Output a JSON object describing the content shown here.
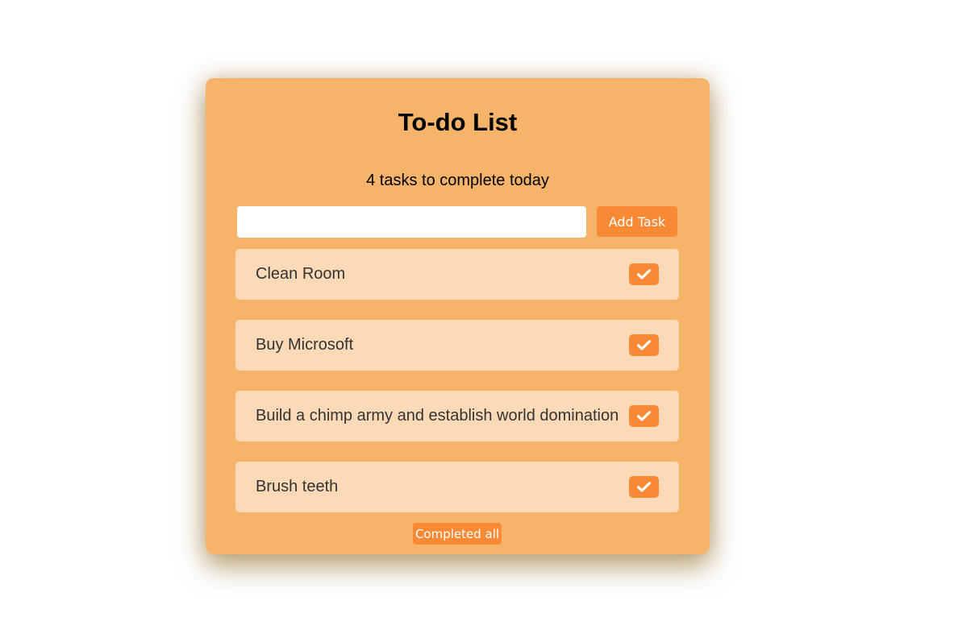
{
  "app": {
    "title": "To-do List",
    "summary": "4 tasks to complete today"
  },
  "input": {
    "value": "",
    "placeholder": ""
  },
  "buttons": {
    "add_label": "Add Task",
    "complete_all_label": "Completed all"
  },
  "tasks": [
    {
      "label": "Clean Room",
      "icon": "check-icon"
    },
    {
      "label": "Buy Microsoft",
      "icon": "check-icon"
    },
    {
      "label": "Build a chimp army and establish world domination",
      "icon": "check-icon"
    },
    {
      "label": "Brush teeth",
      "icon": "check-icon"
    }
  ],
  "colors": {
    "card_background": "#f6b46b",
    "task_background": "#fcd9b7",
    "accent": "#f98a35",
    "button_text": "#ffffff"
  }
}
